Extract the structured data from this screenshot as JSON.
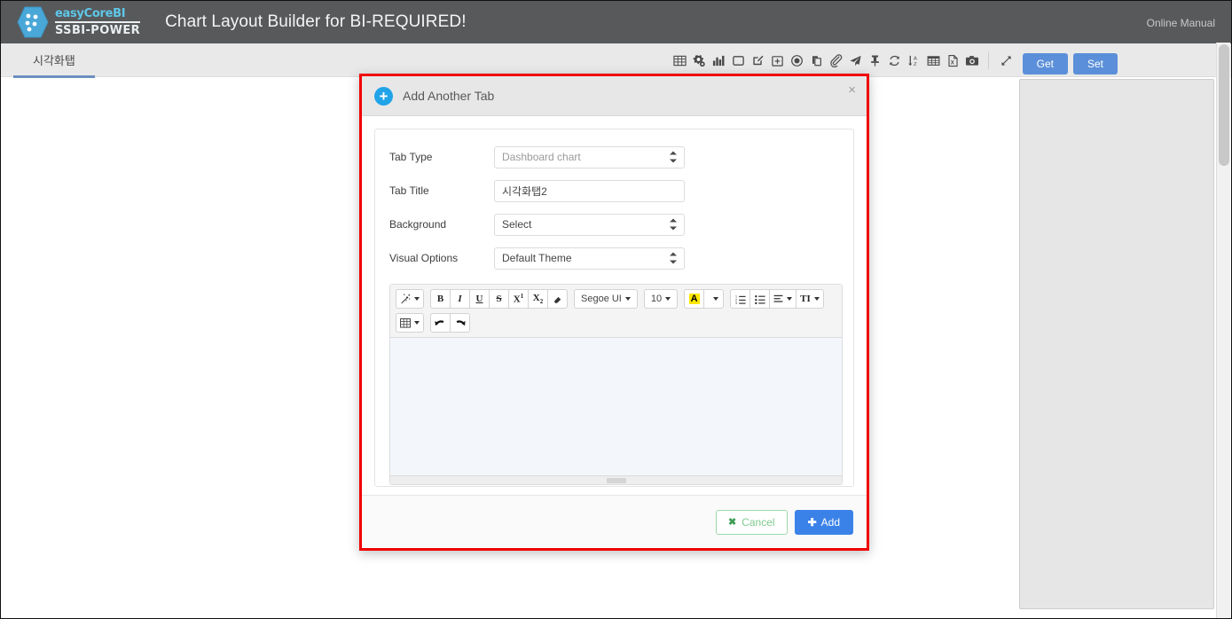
{
  "app": {
    "logo_line1": "easyCoreBI",
    "logo_line2": "SSBI-POWER",
    "title": "Chart Layout Builder for BI-REQUIRED!",
    "online_manual": "Online Manual"
  },
  "tabs": [
    {
      "label": "시각화탭",
      "active": true
    }
  ],
  "toolbar": {
    "icons": [
      {
        "name": "table-grid-icon",
        "title": "Table"
      },
      {
        "name": "settings-gears-icon",
        "title": "Settings"
      },
      {
        "name": "bar-chart-icon",
        "title": "Chart"
      },
      {
        "name": "square-panel-icon",
        "title": "Panel"
      },
      {
        "name": "edit-square-icon",
        "title": "Edit"
      },
      {
        "name": "plus-square-icon",
        "title": "Add"
      },
      {
        "name": "delete-circle-icon",
        "title": "Delete"
      },
      {
        "name": "copy-icon",
        "title": "Copy"
      },
      {
        "name": "paperclip-icon",
        "title": "Attach"
      },
      {
        "name": "send-paper-plane-icon",
        "title": "Send"
      },
      {
        "name": "pin-icon",
        "title": "Pin"
      },
      {
        "name": "refresh-icon",
        "title": "Refresh"
      },
      {
        "name": "sort-az-icon",
        "title": "Sort"
      },
      {
        "name": "grid-table-icon",
        "title": "Grid"
      },
      {
        "name": "export-excel-icon",
        "title": "Export Excel"
      },
      {
        "name": "camera-icon",
        "title": "Snapshot"
      }
    ],
    "expand_icon": "expand-arrows-icon",
    "get_label": "Get",
    "set_label": "Set"
  },
  "modal": {
    "title": "Add Another Tab",
    "plus_icon": "plus-circle-icon",
    "close_icon": "×",
    "fields": [
      {
        "label": "Tab Type",
        "name": "tab-type",
        "control": "select",
        "value": "Dashboard chart",
        "is_placeholder": true
      },
      {
        "label": "Tab Title",
        "name": "tab-title",
        "control": "text",
        "value": "시각화탭2",
        "is_placeholder": false
      },
      {
        "label": "Background",
        "name": "background",
        "control": "select",
        "value": "Select",
        "is_placeholder": false
      },
      {
        "label": "Visual Options",
        "name": "visual-options",
        "control": "select",
        "value": "Default Theme",
        "is_placeholder": false
      }
    ],
    "editor": {
      "row1": [
        {
          "name": "magic-style-icon",
          "glyph": "magic",
          "caret": true
        },
        {
          "name": "bold-button",
          "glyph": "B",
          "caret": false
        },
        {
          "name": "italic-button",
          "glyph": "I",
          "caret": false
        },
        {
          "name": "underline-button",
          "glyph": "U",
          "caret": false
        },
        {
          "name": "strikethrough-button",
          "glyph": "S",
          "caret": false
        },
        {
          "name": "superscript-button",
          "glyph": "X¹",
          "caret": false
        },
        {
          "name": "subscript-button",
          "glyph": "X₂",
          "caret": false
        },
        {
          "name": "clear-format-button",
          "glyph": "eraser",
          "caret": false
        },
        {
          "name": "font-family-select",
          "glyph": "Segoe UI",
          "caret": true
        },
        {
          "name": "font-size-select",
          "glyph": "10",
          "caret": true
        },
        {
          "name": "text-color-button",
          "glyph": "A",
          "caret": false
        },
        {
          "name": "text-color-dropdown",
          "glyph": "",
          "caret": true
        },
        {
          "name": "ordered-list-button",
          "glyph": "ol",
          "caret": false
        },
        {
          "name": "unordered-list-button",
          "glyph": "ul",
          "caret": false
        },
        {
          "name": "align-button",
          "glyph": "align",
          "caret": true
        },
        {
          "name": "line-height-button",
          "glyph": "TI",
          "caret": true
        }
      ],
      "row2": [
        {
          "name": "insert-table-button",
          "glyph": "table",
          "caret": true
        },
        {
          "name": "undo-button",
          "glyph": "undo",
          "caret": false
        },
        {
          "name": "redo-button",
          "glyph": "redo",
          "caret": false
        }
      ],
      "content": ""
    },
    "footer": {
      "cancel_label": "Cancel",
      "cancel_icon": "✖",
      "add_label": "Add",
      "add_icon": "✚"
    }
  },
  "colors": {
    "topbar_bg": "#58595b",
    "accent_blue": "#5b8fd9",
    "modal_border_red": "#f00000",
    "cancel_green": "#7fc98f",
    "add_blue": "#3b82e8",
    "logo_cyan": "#5ec7e8"
  }
}
